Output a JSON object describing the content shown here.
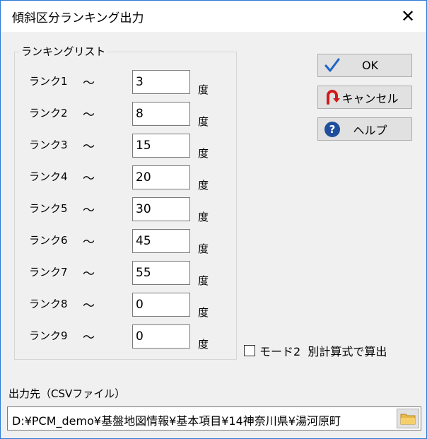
{
  "window": {
    "title": "傾斜区分ランキング出力"
  },
  "group": {
    "label": "ランキングリスト"
  },
  "ranks": [
    {
      "label": "ランク1",
      "tilde": "～",
      "value": "3",
      "unit": "度"
    },
    {
      "label": "ランク2",
      "tilde": "～",
      "value": "8",
      "unit": "度"
    },
    {
      "label": "ランク3",
      "tilde": "～",
      "value": "15",
      "unit": "度"
    },
    {
      "label": "ランク4",
      "tilde": "～",
      "value": "20",
      "unit": "度"
    },
    {
      "label": "ランク5",
      "tilde": "～",
      "value": "30",
      "unit": "度"
    },
    {
      "label": "ランク6",
      "tilde": "～",
      "value": "45",
      "unit": "度"
    },
    {
      "label": "ランク7",
      "tilde": "～",
      "value": "55",
      "unit": "度"
    },
    {
      "label": "ランク8",
      "tilde": "～",
      "value": "0",
      "unit": "度"
    },
    {
      "label": "ランク9",
      "tilde": "～",
      "value": "0",
      "unit": "度"
    }
  ],
  "buttons": {
    "ok": "OK",
    "cancel": "キャンセル",
    "help": "ヘルプ"
  },
  "mode": {
    "label": "モード2  別計算式で算出",
    "checked": false
  },
  "output": {
    "label": "出力先（CSVファイル）",
    "path": "D:¥PCM_demo¥基盤地図情報¥基本項目¥14神奈川県¥湯河原町"
  },
  "colors": {
    "accent": "#2b79d6",
    "check": "#1e64c8",
    "cancel": "#d0191b",
    "help": "#1f4e9c",
    "folder": "#e8b84a"
  }
}
